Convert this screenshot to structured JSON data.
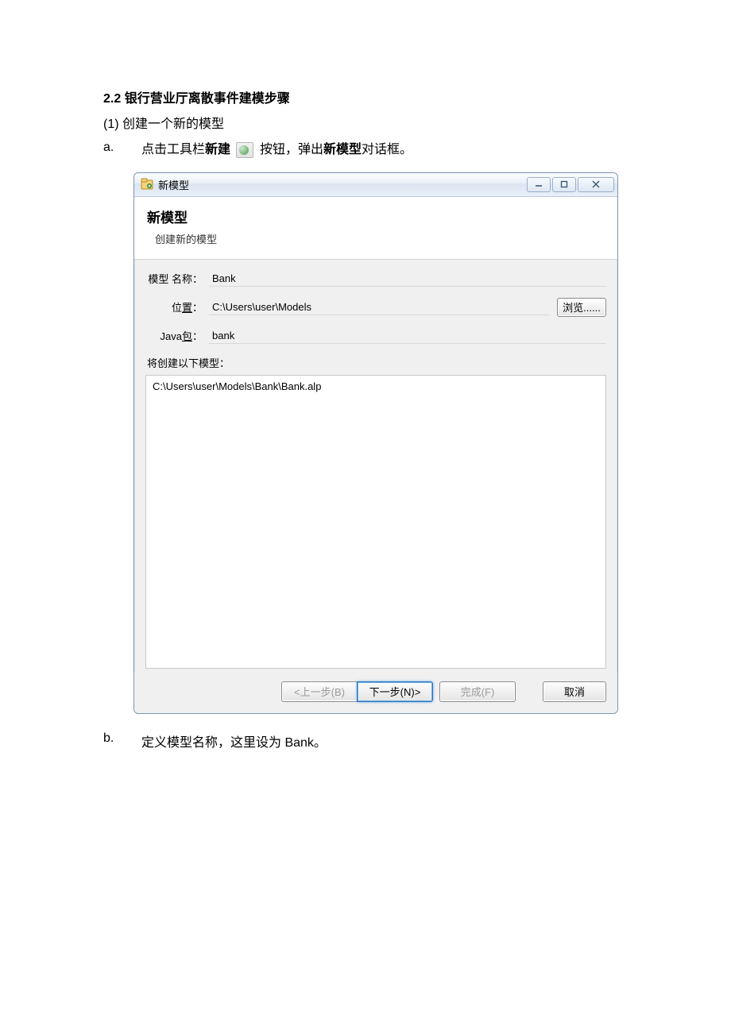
{
  "doc": {
    "section_title": "2.2 银行营业厅离散事件建模步骤",
    "step1": "(1)  创建一个新的模型",
    "a_marker": "a.",
    "a_pre": "点击工具栏",
    "a_bold1": "新建",
    "a_mid": " 按钮，弹出",
    "a_bold2": "新模型",
    "a_post": "对话框。",
    "b_marker": "b.",
    "b_text": "定义模型名称，这里设为 Bank。"
  },
  "dialog": {
    "window_title": "新模型",
    "header_title": "新模型",
    "header_sub": "创建新的模型",
    "label_name": "模型 名称：",
    "value_name": "Bank",
    "label_location_pre": "位",
    "label_location_underline": "置",
    "label_location_post": "：",
    "value_location": "C:\\Users\\user\\Models",
    "browse": "浏览......",
    "label_java_pre": "Java",
    "label_java_underline": "包",
    "label_java_post": "：",
    "value_java": "bank",
    "sub_label": "将创建以下模型：",
    "path_text": "C:\\Users\\user\\Models\\Bank\\Bank.alp",
    "btn_back": "<上一步(B)",
    "btn_next": "下一步(N)>",
    "btn_finish": "完成(F)",
    "btn_cancel": "取消"
  }
}
